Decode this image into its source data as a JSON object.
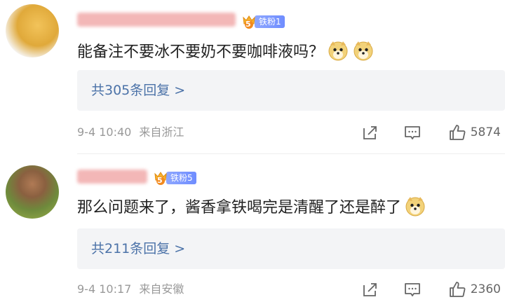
{
  "comments": [
    {
      "nickname": "█████████████",
      "badge": {
        "level": "5",
        "label": "铁粉1"
      },
      "text": "能备注不要冰不要奶不要咖啡液吗？",
      "emoji_count": 2,
      "replies": "共305条回复 >",
      "time": "9-4 10:40",
      "location": "来自浙江",
      "likes": "5874"
    },
    {
      "nickname": "███████",
      "badge": {
        "level": "5",
        "label": "铁粉5"
      },
      "text": "那么问题来了，酱香拿铁喝完是清醒了还是醉了",
      "emoji_count": 1,
      "replies": "共211条回复 >",
      "time": "9-4 10:17",
      "location": "来自安徽",
      "likes": "2360"
    }
  ],
  "icons": {
    "share": "share-icon",
    "comment": "comment-icon",
    "like": "thumbs-up-icon",
    "emoji": "doge-emoji-icon"
  },
  "colors": {
    "reply_link": "#4b72a8",
    "badge": "#6f8dff",
    "meta": "#999999"
  }
}
